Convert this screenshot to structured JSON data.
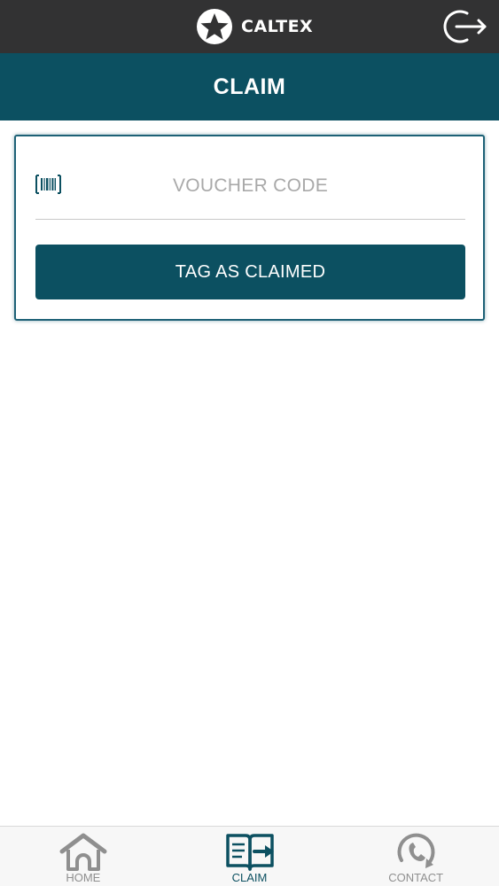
{
  "header": {
    "brand": "CALTEX",
    "logo_icon": "caltex-star-logo",
    "logout_icon": "logout-icon"
  },
  "page": {
    "title": "CLAIM"
  },
  "claim_form": {
    "voucher_placeholder": "VOUCHER CODE",
    "voucher_value": "",
    "barcode_icon": "barcode-icon",
    "submit_label": "TAG AS CLAIMED"
  },
  "bottom_nav": {
    "active": "claim",
    "items": [
      {
        "id": "home",
        "label": "HOME",
        "icon": "home-icon"
      },
      {
        "id": "claim",
        "label": "CLAIM",
        "icon": "claim-icon"
      },
      {
        "id": "contact",
        "label": "CONTACT",
        "icon": "contact-icon"
      }
    ]
  },
  "colors": {
    "topbar": "#323233",
    "primary": "#0c5061",
    "nav_inactive": "#8f8f8f",
    "background": "#ffffff"
  }
}
